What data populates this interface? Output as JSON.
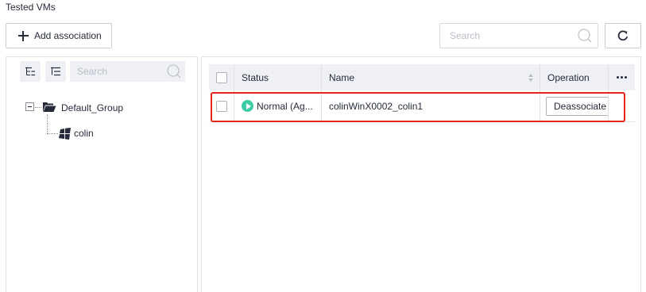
{
  "section_title": "Tested VMs",
  "toolbar": {
    "add_association_label": "Add association",
    "search_placeholder": "Search",
    "refresh_icon": "refresh-icon"
  },
  "tree": {
    "search_placeholder": "Search",
    "tool_icons": [
      "collapse-tree-icon",
      "expand-tree-icon"
    ],
    "group": {
      "label": "Default_Group",
      "icon": "folder-open-icon",
      "expanded": true
    },
    "vm": {
      "label": "colin",
      "icon": "windows-icon"
    }
  },
  "table": {
    "columns": {
      "status": "Status",
      "name": "Name",
      "operation": "Operation"
    },
    "rows": [
      {
        "status": "Normal (Ag...",
        "status_color": "#3dcca6",
        "name": "colinWinX0002_colin1",
        "operation_label": "Deassociate"
      }
    ],
    "highlight_color": "#e5241c"
  }
}
